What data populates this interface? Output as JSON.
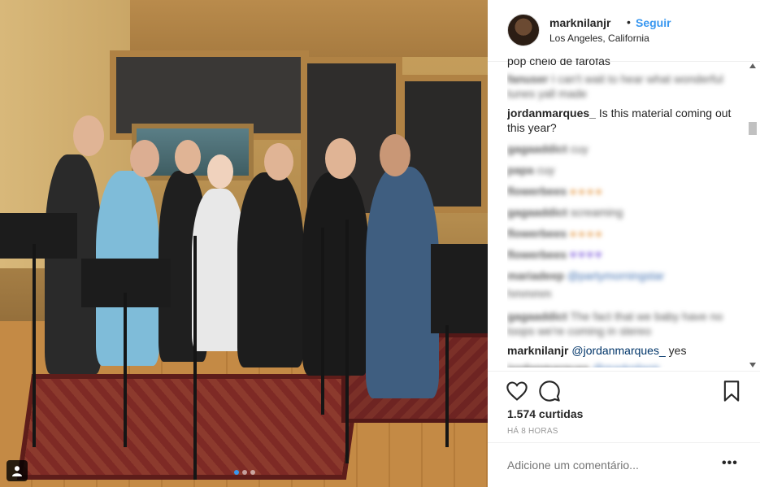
{
  "header": {
    "username": "marknilanjr",
    "separator": "•",
    "follow_label": "Seguir",
    "location": "Los Angeles, California"
  },
  "comments": [
    {
      "username": "",
      "text": "pop cheio de farofas",
      "blurred": false,
      "partial": true
    },
    {
      "username": "",
      "text": "I can't wait to hear what wonderful tunes yall made",
      "blurred": true
    },
    {
      "username": "jordanmarques_",
      "text": "Is this material coming out this year?",
      "blurred": false
    },
    {
      "username": "",
      "text": "cuy",
      "blurred": true
    },
    {
      "username": "",
      "text": "cuy",
      "blurred": true
    },
    {
      "username": "",
      "text": "",
      "emoji": "●●●●",
      "emoji_color": "orange",
      "blurred": true
    },
    {
      "username": "",
      "text": "screaming",
      "blurred": true
    },
    {
      "username": "",
      "text": "",
      "emoji": "●●●●",
      "emoji_color": "orange",
      "blurred": true
    },
    {
      "username": "",
      "text": "",
      "emoji": "♥♥♥♥",
      "emoji_color": "purple",
      "blurred": true
    },
    {
      "username": "",
      "text": "",
      "mention": "",
      "blurred": true
    },
    {
      "username": "",
      "text": "",
      "blurred": true
    },
    {
      "username": "",
      "text": "The fact that we baby have no loops we're coming in stereo",
      "blurred": true
    },
    {
      "username": "marknilanjr",
      "mention": "@jordanmarques_",
      "text": "yes",
      "blurred": false
    }
  ],
  "actions": {
    "like_icon": "heart-icon",
    "comment_icon": "comment-bubble-icon",
    "save_icon": "bookmark-icon",
    "likes_text": "1.574 curtidas",
    "time_text": "HÁ 8 HORAS"
  },
  "add_comment": {
    "placeholder": "Adicione um comentário...",
    "more_label": "•••"
  },
  "photo": {
    "user_tag_icon": "user-silhouette-icon",
    "carousel_total": 3,
    "carousel_active": 1
  },
  "colors": {
    "link_blue": "#3897f0",
    "mention_blue": "#003569",
    "border": "#efefef",
    "muted": "#999999"
  }
}
